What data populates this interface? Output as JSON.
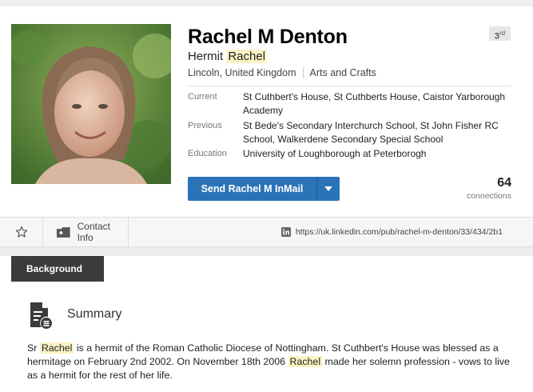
{
  "profile": {
    "name": "Rachel M Denton",
    "degree_num": "3",
    "degree_suffix": "rd",
    "headline_prefix": "Hermit ",
    "headline_highlight": "Rachel",
    "location": "Lincoln, United Kingdom",
    "industry": "Arts and Crafts"
  },
  "details": [
    {
      "label": "Current",
      "value": "St Cuthbert's House, St Cuthberts House, Caistor Yarborough Academy"
    },
    {
      "label": "Previous",
      "value": "St Bede's Secondary Interchurch School, St John Fisher RC School, Walkerdene Secondary Special School"
    },
    {
      "label": "Education",
      "value": "University of Loughborough at Peterborogh"
    }
  ],
  "actions": {
    "inmail_label": "Send Rachel M InMail",
    "connections_count": "64",
    "connections_label": "connections",
    "contact_info_label": "Contact Info",
    "profile_url": "https://uk.linkedin.com/pub/rachel-m-denton/33/434/2b1"
  },
  "background": {
    "tab_label": "Background",
    "summary_title": "Summary",
    "summary_parts": [
      "Sr ",
      "Rachel",
      " is a hermit of the Roman Catholic Diocese of Nottingham. St Cuthbert's House was blessed as a hermitage on February 2nd 2002. On November 18th 2006 ",
      "Rachel",
      " made her solemn profession - vows to live as a hermit for the rest of her life."
    ]
  },
  "colors": {
    "inmail_blue": "#2a73b7",
    "highlight": "#fdf3c4",
    "tab_dark": "#3b3b3b"
  },
  "icons": [
    "profile-photo",
    "star-icon",
    "address-card-icon",
    "linkedin-icon",
    "summary-document-icon",
    "chevron-down-icon"
  ]
}
